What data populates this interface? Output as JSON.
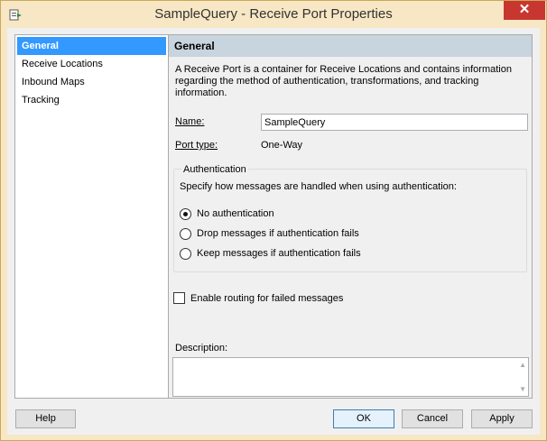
{
  "window": {
    "title": "SampleQuery - Receive Port Properties",
    "close_glyph": "✕",
    "app_icon": "receive-port-icon"
  },
  "nav": {
    "items": [
      {
        "label": "General",
        "selected": true
      },
      {
        "label": "Receive Locations",
        "selected": false
      },
      {
        "label": "Inbound Maps",
        "selected": false
      },
      {
        "label": "Tracking",
        "selected": false
      }
    ]
  },
  "panel": {
    "header": "General",
    "description": "A Receive Port is a container for Receive Locations and contains information regarding the method of authentication, transformations, and tracking information.",
    "name_label": "Name:",
    "name_value": "SampleQuery",
    "port_type_label": "Port type:",
    "port_type_value": "One-Way",
    "auth_group_label": "Authentication",
    "auth_instruction": "Specify how messages are handled when using authentication:",
    "auth_options": [
      {
        "label": "No authentication",
        "checked": true
      },
      {
        "label": "Drop messages if authentication fails",
        "checked": false
      },
      {
        "label": "Keep messages if authentication fails",
        "checked": false
      }
    ],
    "enable_routing_label": "Enable routing for failed messages",
    "enable_routing_checked": false,
    "description_label": "Description:",
    "description_value": ""
  },
  "buttons": {
    "help": "Help",
    "ok": "OK",
    "cancel": "Cancel",
    "apply": "Apply"
  },
  "colors": {
    "selection": "#3399ff",
    "header_bg": "#c8d4de",
    "close_bg": "#c7372f"
  }
}
